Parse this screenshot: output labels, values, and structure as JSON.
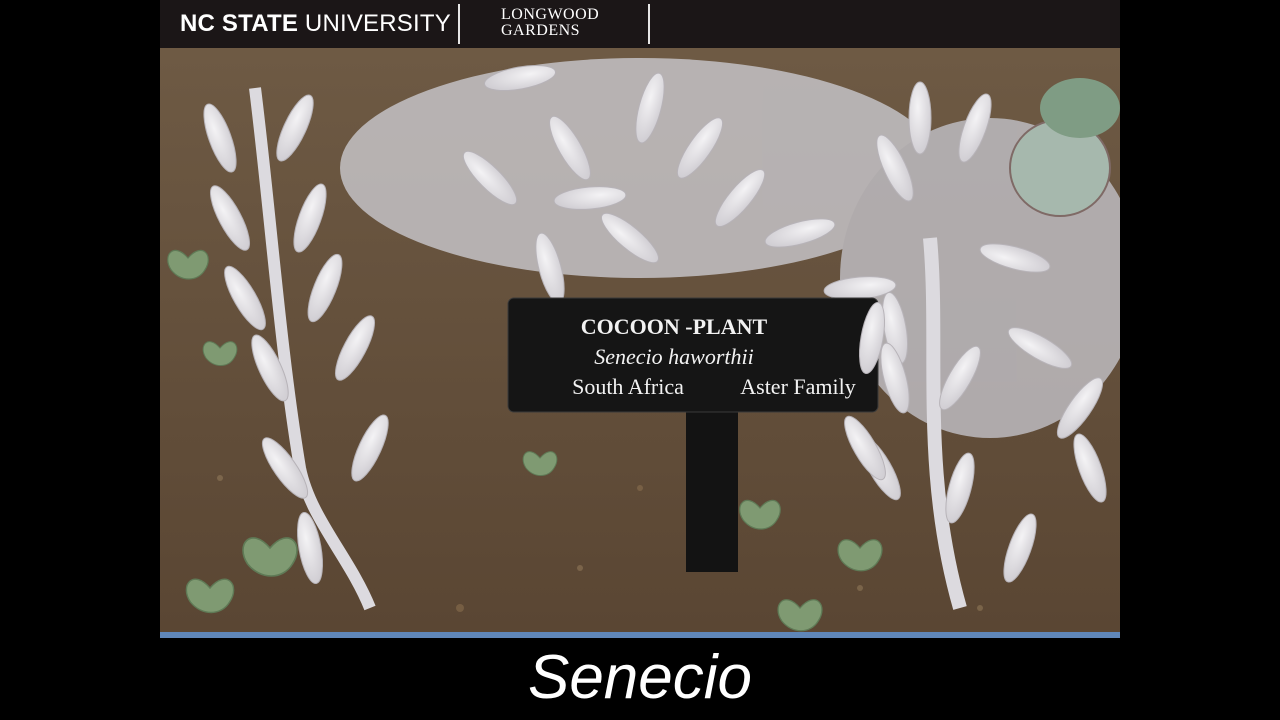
{
  "header": {
    "university_bold": "NC STATE",
    "university_light": "UNIVERSITY",
    "partner_line1": "LONGWOOD",
    "partner_line2": "GARDENS"
  },
  "photo": {
    "sign": {
      "common_name": "COCOON -PLANT",
      "scientific_name": "Senecio haworthii",
      "origin": "South Africa",
      "family": "Aster Family"
    }
  },
  "caption": "Senecio",
  "colors": {
    "header_bg": "#1b1617",
    "accent_bar": "#5f86b8",
    "background": "#000000",
    "caption_text": "#ffffff"
  }
}
